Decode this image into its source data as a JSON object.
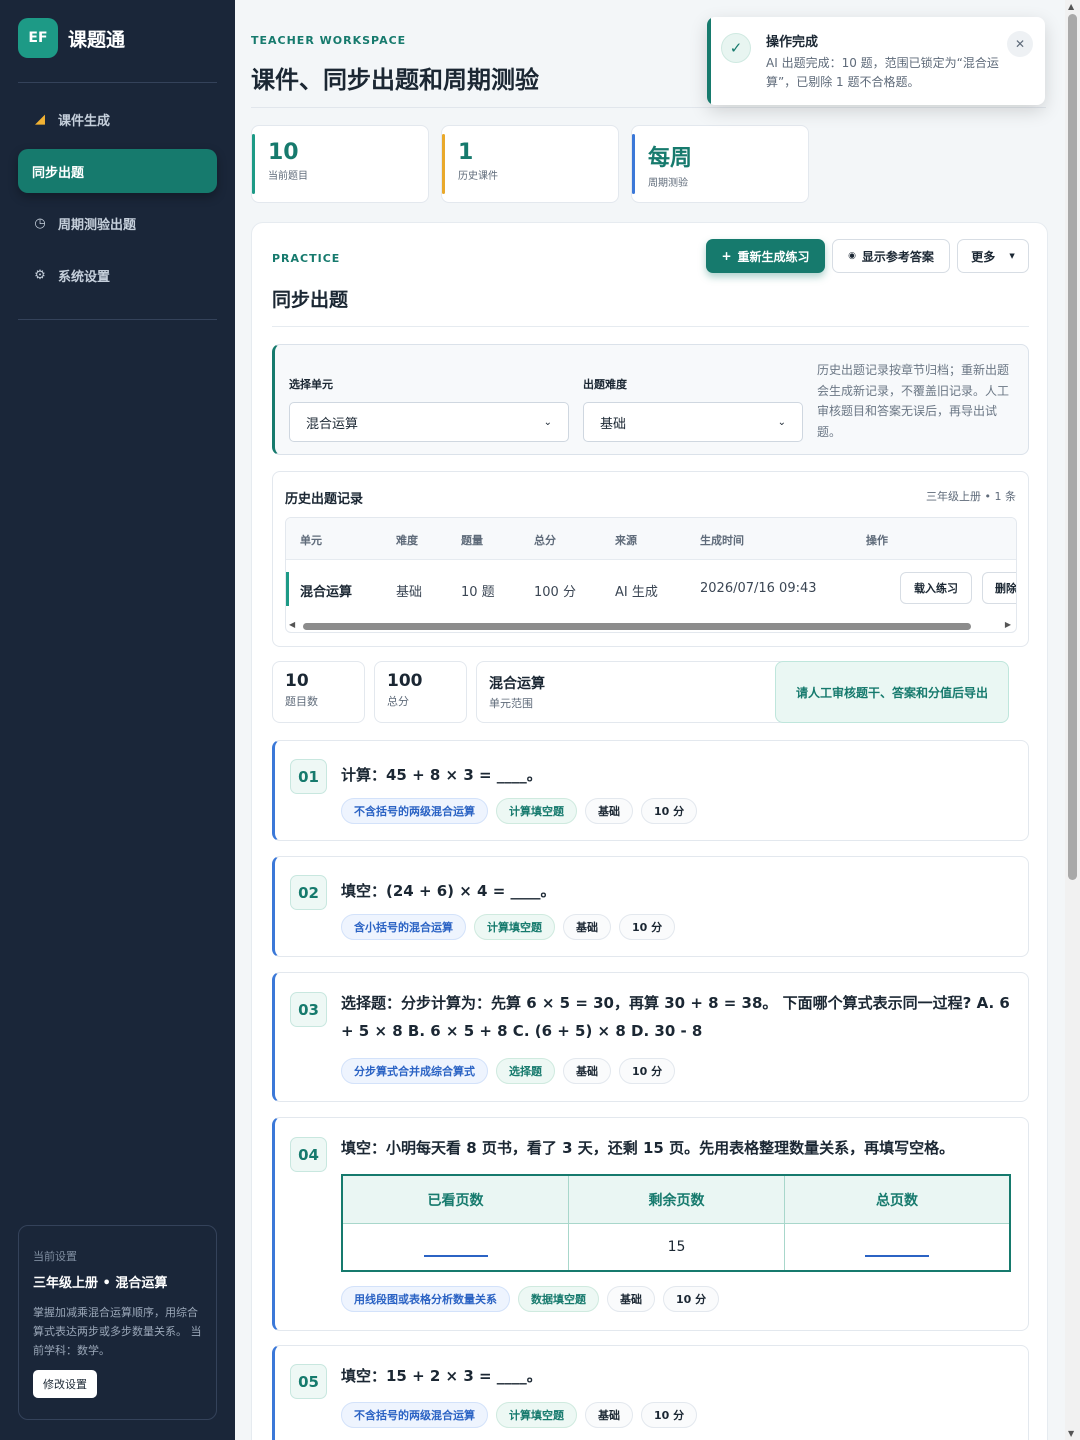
{
  "brand": {
    "logo": "EF",
    "name": "课题通"
  },
  "nav": [
    {
      "label": "课件生成",
      "icon": "ruler-triangle-icon"
    },
    {
      "label": "同步出题",
      "icon": "none"
    },
    {
      "label": "周期测验出题",
      "icon": "clock-icon"
    },
    {
      "label": "系统设置",
      "icon": "gear-icon"
    }
  ],
  "settings": {
    "label": "当前设置",
    "title": "三年级上册 • 混合运算",
    "desc": "掌握加减乘混合运算顺序，用综合算式表达两步或多步数量关系。 当前学科：数学。",
    "button": "修改设置"
  },
  "header": {
    "eyebrow": "TEACHER WORKSPACE",
    "title": "课件、同步出题和周期测验"
  },
  "stats": [
    {
      "value": "10",
      "label": "当前题目",
      "color": "#1d9a86"
    },
    {
      "value": "1",
      "label": "历史课件",
      "color": "#e9a92b"
    },
    {
      "value": "每周",
      "label": "周期测验",
      "color": "#3b78d8"
    }
  ],
  "panel": {
    "eyebrow": "PRACTICE",
    "title": "同步出题",
    "regen": "重新生成练习",
    "show_answer": "显示参考答案",
    "more": "更多"
  },
  "filter": {
    "unit_label": "选择单元",
    "unit_value": "混合运算",
    "difficulty_label": "出题难度",
    "difficulty_value": "基础",
    "note": "历史出题记录按章节归档；重新出题会生成新记录，不覆盖旧记录。人工审核题目和答案无误后，再导出试题。"
  },
  "history": {
    "title": "历史出题记录",
    "meta": "三年级上册 • 1 条",
    "columns": [
      "单元",
      "难度",
      "题量",
      "总分",
      "来源",
      "生成时间",
      "操作"
    ],
    "rows": [
      {
        "unit": "混合运算",
        "difficulty": "基础",
        "count": "10 题",
        "score": "100 分",
        "source": "AI 生成",
        "time": "2026/07/16 09:43",
        "load": "载入练习",
        "delete": "删除"
      }
    ]
  },
  "summary": [
    {
      "value": "10",
      "label": "题目数"
    },
    {
      "value": "100",
      "label": "总分"
    },
    {
      "value": "混合运算",
      "label": "单元范围"
    }
  ],
  "summary_note": "请人工审核题干、答案和分值后导出",
  "questions": [
    {
      "no": "01",
      "text": "计算：45 + 8 × 3 = ____。",
      "tags": [
        "不含括号的两级混合运算",
        "计算填空题",
        "基础",
        "10 分"
      ]
    },
    {
      "no": "02",
      "text": "填空：(24 + 6) × 4 = ____。",
      "tags": [
        "含小括号的混合运算",
        "计算填空题",
        "基础",
        "10 分"
      ]
    },
    {
      "no": "03",
      "text": "选择题：分步计算为：先算 6 × 5 = 30，再算 30 + 8 = 38。 下面哪个算式表示同一过程? A. 6 + 5 × 8 B. 6 × 5 + 8 C. (6 + 5) × 8 D. 30 - 8",
      "tags": [
        "分步算式合并成综合算式",
        "选择题",
        "基础",
        "10 分"
      ]
    },
    {
      "no": "04",
      "text": "填空：小明每天看 8 页书，看了 3 天，还剩 15 页。先用表格整理数量关系，再填写空格。",
      "table": {
        "headers": [
          "已看页数",
          "剩余页数",
          "总页数"
        ],
        "cells": [
          "",
          "15",
          ""
        ]
      },
      "tags": [
        "用线段图或表格分析数量关系",
        "数据填空题",
        "基础",
        "10 分"
      ]
    },
    {
      "no": "05",
      "text": "填空：15 + 2 × 3 = ____。",
      "tags": [
        "不含括号的两级混合运算",
        "计算填空题",
        "基础",
        "10 分"
      ]
    }
  ],
  "toast": {
    "title": "操作完成",
    "body": "AI 出题完成：10 题，范围已锁定为“混合运算”，已剔除 1 题不合格题。"
  }
}
